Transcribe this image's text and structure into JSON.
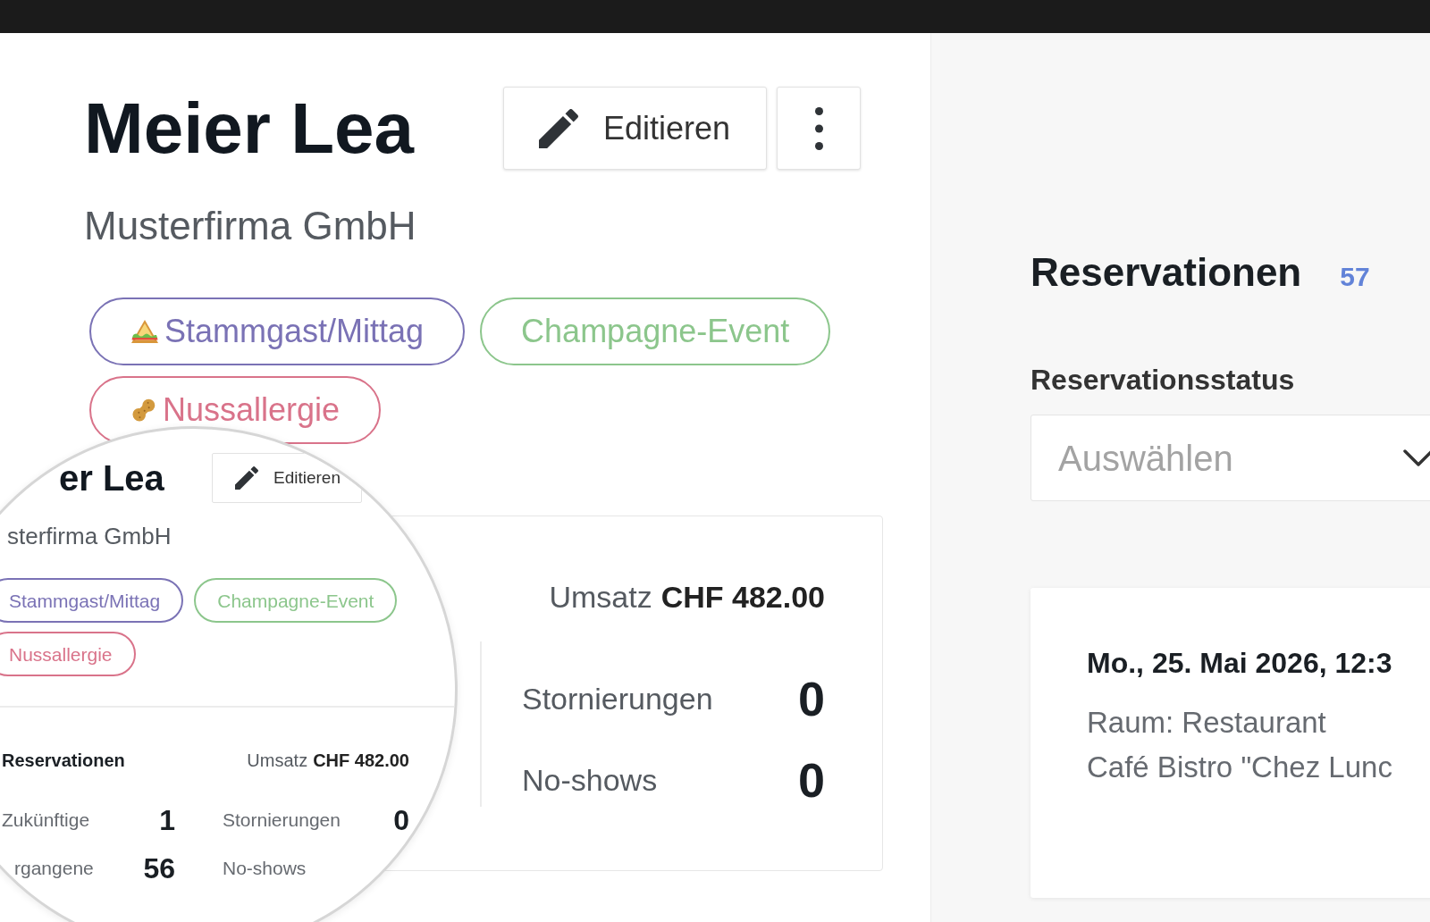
{
  "customer": {
    "name": "Meier Lea",
    "company": "Musterfirma GmbH"
  },
  "actions": {
    "edit": "Editieren"
  },
  "tags": [
    {
      "label": "Stammgast/Mittag",
      "kind": "regular",
      "color": "#7a72b5"
    },
    {
      "label": "Champagne-Event",
      "kind": "event",
      "color": "#8cc68c"
    },
    {
      "label": "Nussallergie",
      "kind": "allergy",
      "color": "#d9738a"
    }
  ],
  "stats": {
    "revenue_label": "Umsatz",
    "revenue_value": "CHF 482.00",
    "counts": [
      {
        "label": "Stornierungen",
        "value": "0"
      },
      {
        "label": "No-shows",
        "value": "0"
      }
    ]
  },
  "magnifier": {
    "name": "er Lea",
    "edit": "Editieren",
    "company": "sterfirma GmbH",
    "tags": [
      {
        "label": "Stammgast/Mittag",
        "color": "#7a72b5"
      },
      {
        "label": "Champagne-Event",
        "color": "#8cc68c"
      },
      {
        "label": "Nussallergie",
        "color": "#d9738a"
      }
    ],
    "heading": "Reservationen",
    "revenue_label": "Umsatz",
    "revenue_value": "CHF 482.00",
    "left_column": [
      {
        "label": "Zukünftige",
        "value": "1"
      },
      {
        "label": "rgangene",
        "value": "56"
      }
    ],
    "right_column": [
      {
        "label": "Stornierungen",
        "value": "0"
      },
      {
        "label": "No-shows"
      }
    ]
  },
  "reservations": {
    "title": "Reservationen",
    "count": "57",
    "status_filter": {
      "label": "Reservationsstatus",
      "placeholder": "Auswählen"
    },
    "items": [
      {
        "date": "Mo., 25. Mai 2026, 12:3",
        "room": "Raum: Restaurant",
        "venue": "Café Bistro \"Chez Lunc"
      }
    ]
  }
}
